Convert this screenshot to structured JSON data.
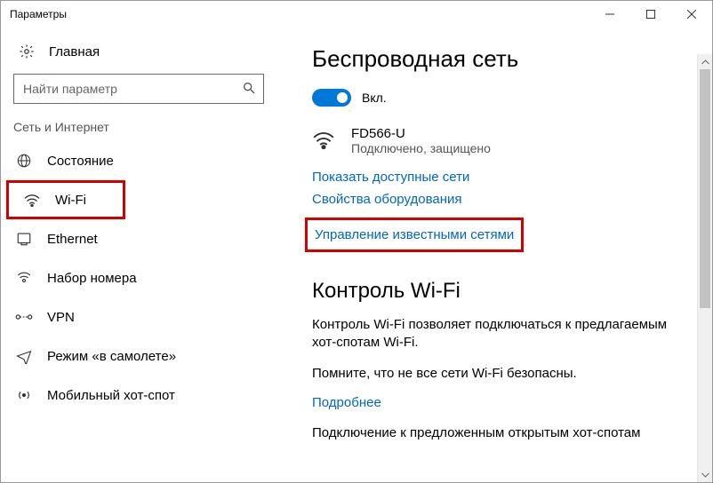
{
  "window": {
    "title": "Параметры"
  },
  "sidebar": {
    "home": "Главная",
    "search_placeholder": "Найти параметр",
    "section": "Сеть и Интернет",
    "items": [
      {
        "label": "Состояние"
      },
      {
        "label": "Wi-Fi"
      },
      {
        "label": "Ethernet"
      },
      {
        "label": "Набор номера"
      },
      {
        "label": "VPN"
      },
      {
        "label": "Режим «в самолете»"
      },
      {
        "label": "Мобильный хот-спот"
      }
    ]
  },
  "main": {
    "title": "Беспроводная сеть",
    "toggle_label": "Вкл.",
    "network": {
      "name": "FD566-U",
      "status": "Подключено, защищено"
    },
    "links": {
      "show_networks": "Показать доступные сети",
      "hw_props": "Свойства оборудования",
      "manage_known": "Управление известными сетями"
    },
    "wifi_control": {
      "title": "Контроль Wi-Fi",
      "p1": "Контроль Wi-Fi позволяет подключаться к предлагаемым хот-спотам Wi-Fi.",
      "p2": "Помните, что не все сети Wi-Fi безопасны.",
      "learn_more": "Подробнее",
      "p3": "Подключение к предложенным открытым хот-спотам"
    }
  }
}
